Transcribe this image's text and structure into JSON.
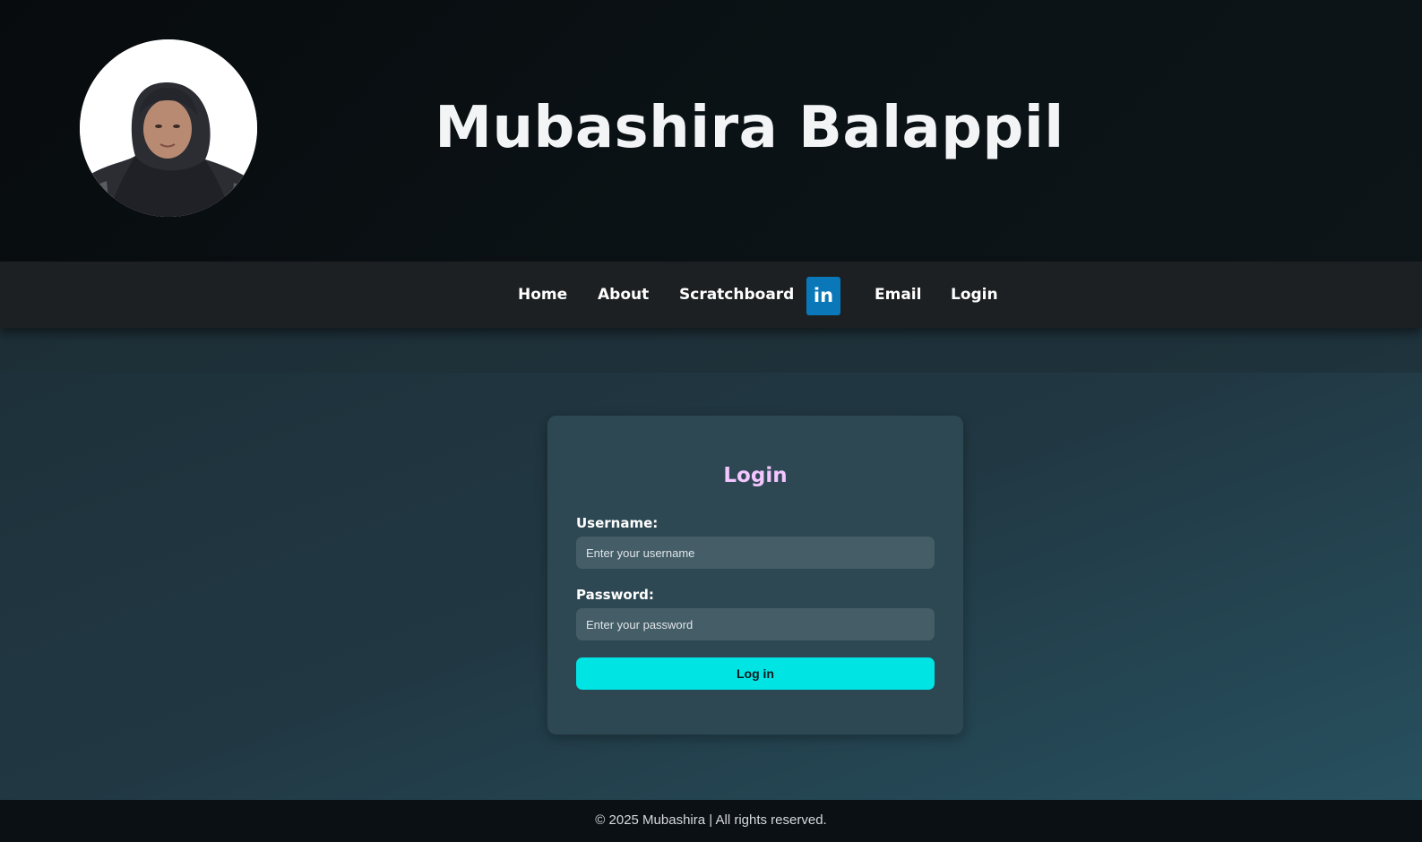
{
  "header": {
    "title": "Mubashira Balappil",
    "avatar_alt": "profile-photo"
  },
  "nav": {
    "items": [
      {
        "label": "Home"
      },
      {
        "label": "About"
      },
      {
        "label": "Scratchboard"
      },
      {
        "label": "in",
        "icon": "linkedin-icon",
        "color": "#0a78b8"
      },
      {
        "label": "Email"
      },
      {
        "label": "Login"
      }
    ]
  },
  "login_form": {
    "title": "Login",
    "username_label": "Username:",
    "username_placeholder": "Enter your username",
    "password_label": "Password:",
    "password_placeholder": "Enter your password",
    "submit_label": "Log in",
    "colors": {
      "title": "#f3c6ff",
      "button": "#00e4e4"
    }
  },
  "footer": {
    "text": "© 2025 Mubashira | All rights reserved."
  }
}
